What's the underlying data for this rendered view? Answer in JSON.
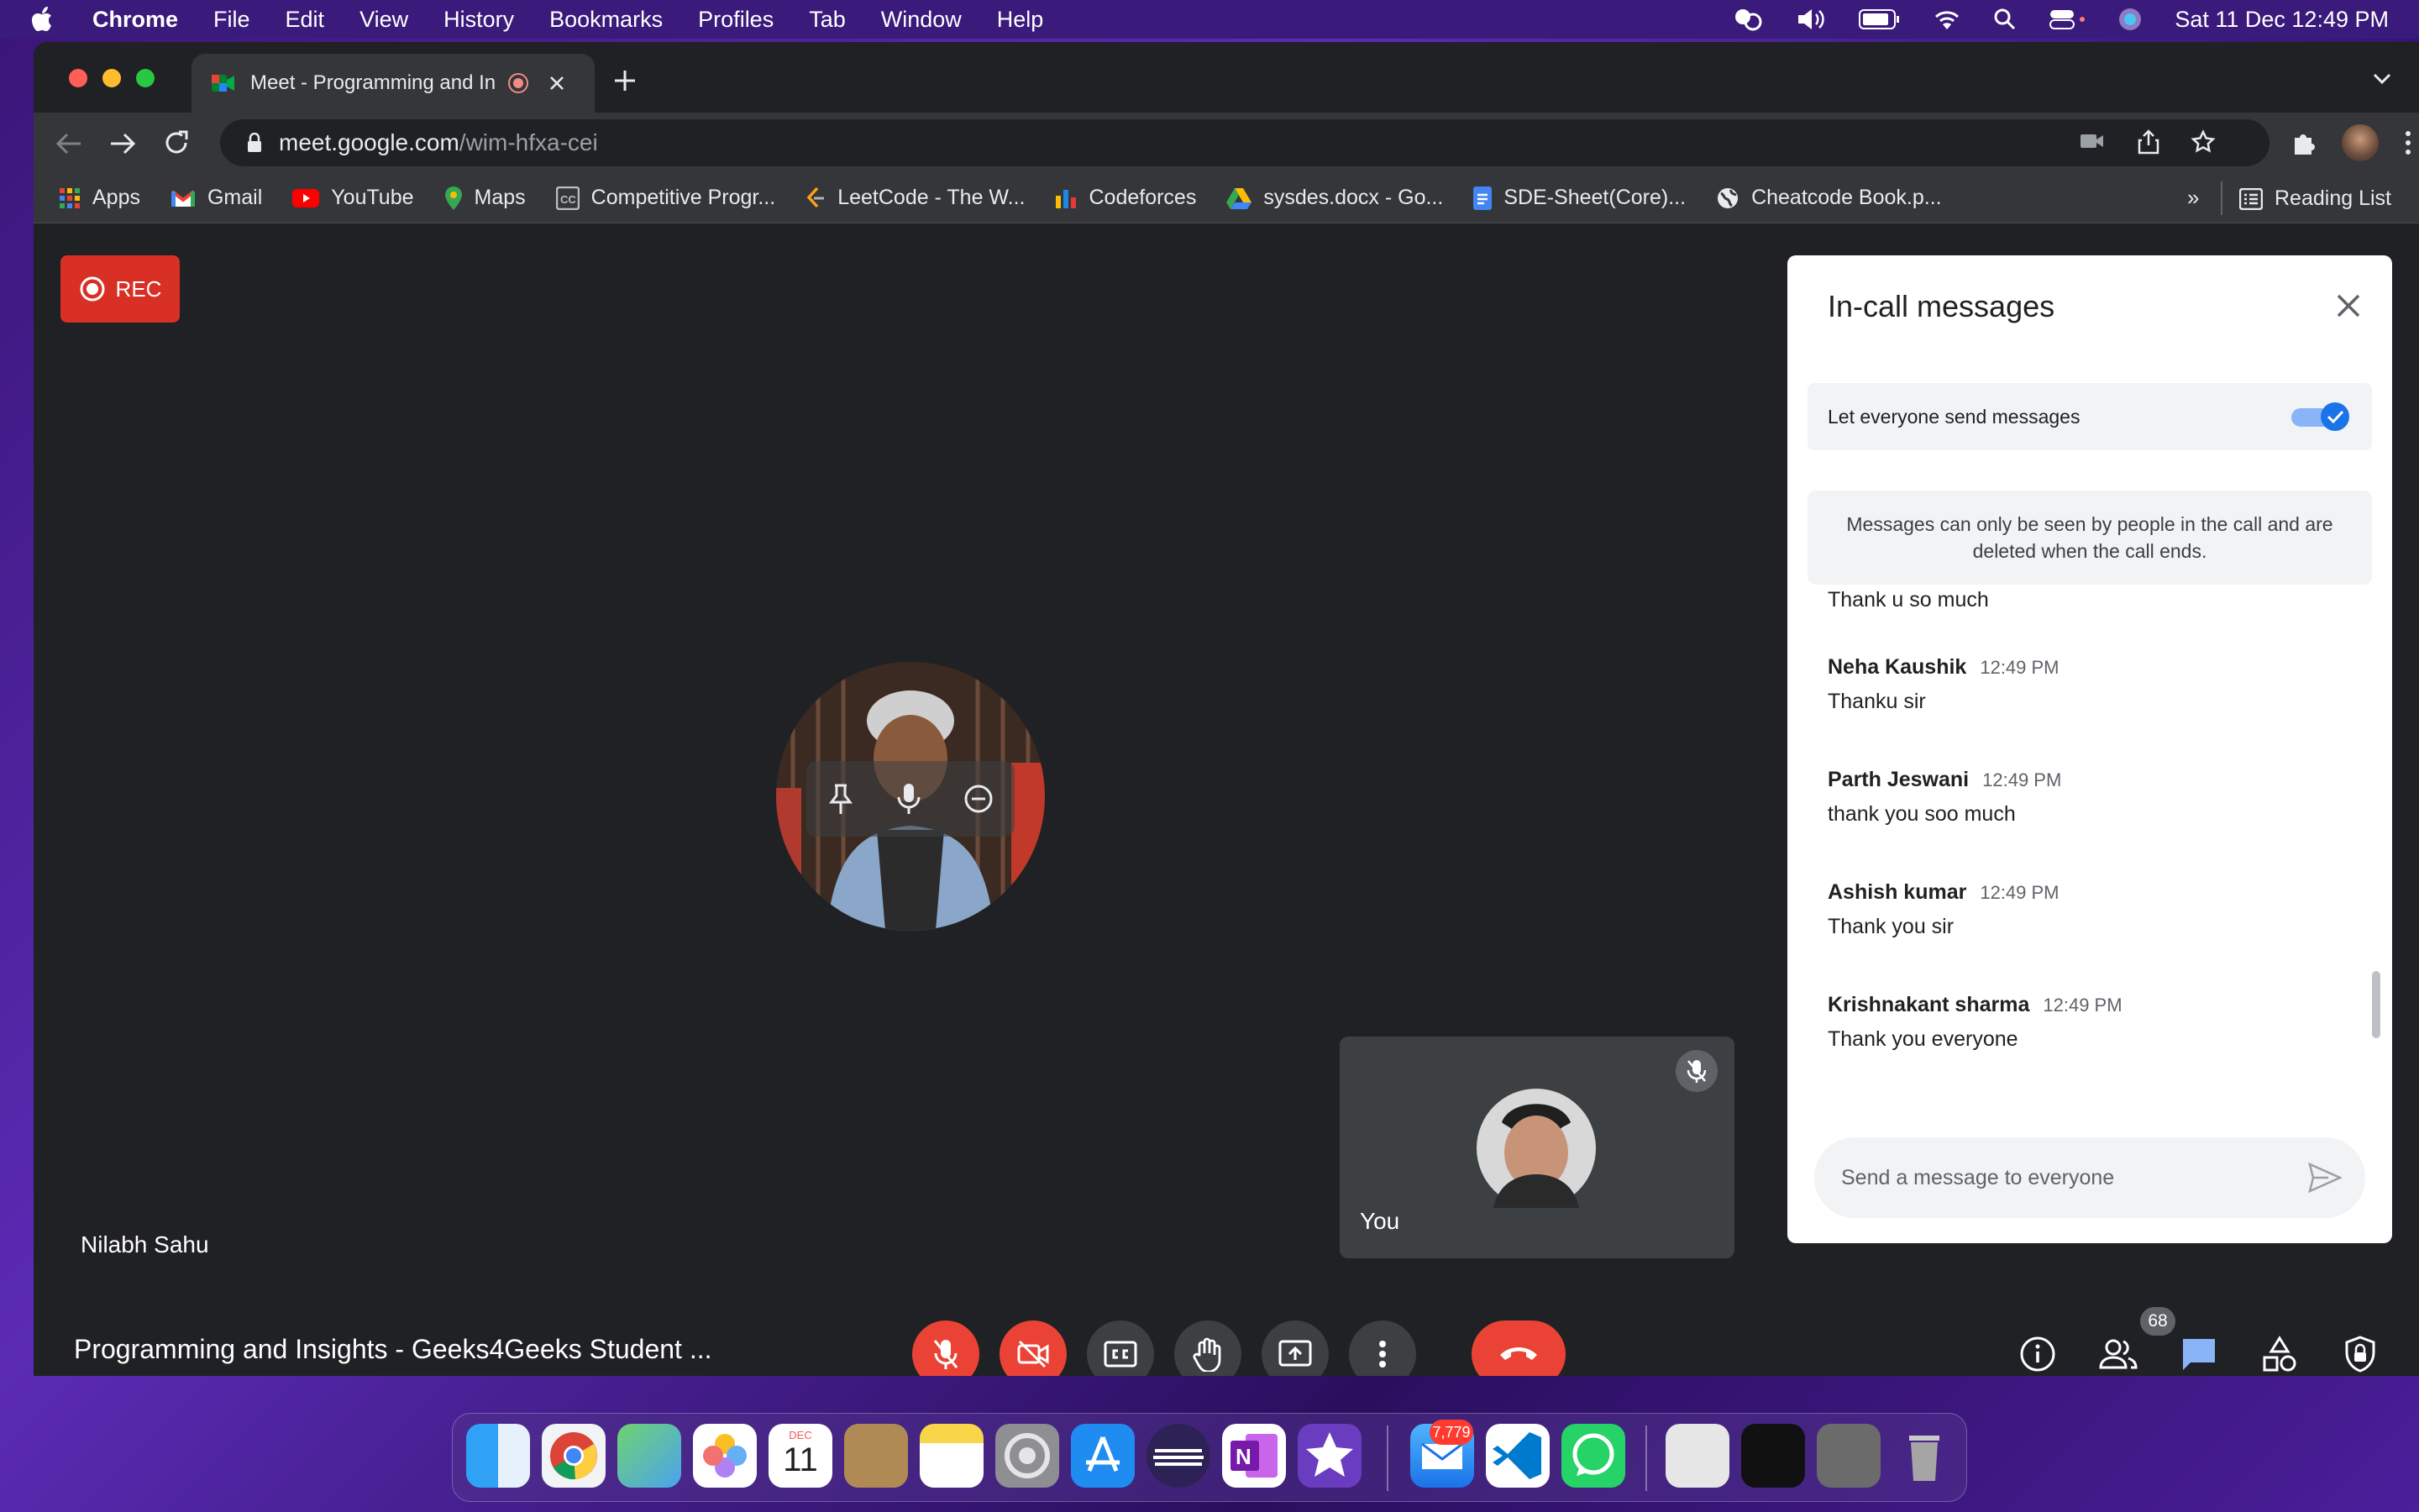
{
  "menubar": {
    "app": "Chrome",
    "items": [
      "File",
      "Edit",
      "View",
      "History",
      "Bookmarks",
      "Profiles",
      "Tab",
      "Window",
      "Help"
    ],
    "clock": "Sat 11 Dec  12:49 PM"
  },
  "browser": {
    "tab_title": "Meet - Programming and In",
    "url_host": "meet.google.com",
    "url_path": "/wim-hfxa-cei",
    "bookmarks": [
      {
        "label": "Apps",
        "icon": "apps-grid-icon",
        "color": "#e94235"
      },
      {
        "label": "Gmail",
        "icon": "gmail-icon",
        "color": "#ea4335"
      },
      {
        "label": "YouTube",
        "icon": "youtube-icon",
        "color": "#ff0000"
      },
      {
        "label": "Maps",
        "icon": "maps-pin-icon",
        "color": "#34a853"
      },
      {
        "label": "Competitive Progr...",
        "icon": "cc-icon",
        "color": "#9e9e9e"
      },
      {
        "label": "LeetCode - The W...",
        "icon": "leetcode-icon",
        "color": "#ffa116"
      },
      {
        "label": "Codeforces",
        "icon": "codeforces-icon",
        "color": "#1e88e5"
      },
      {
        "label": "sysdes.docx - Go...",
        "icon": "drive-icon",
        "color": "#fbbc04"
      },
      {
        "label": "SDE-Sheet(Core)...",
        "icon": "docs-icon",
        "color": "#4285f4"
      },
      {
        "label": "Cheatcode Book.p...",
        "icon": "globe-icon",
        "color": "#e8eaed"
      }
    ],
    "overflow": "»",
    "reading_list": "Reading List"
  },
  "meet": {
    "rec_label": "REC",
    "presenter_name": "Nilabh Sahu",
    "self_label": "You",
    "meeting_title": "Programming and Insights - Geeks4Geeks Student ...",
    "participant_count": "68",
    "accent": "#8ab4f8",
    "danger": "#ea4335"
  },
  "chat": {
    "title": "In-call messages",
    "toggle_label": "Let everyone send messages",
    "toggle_on": true,
    "notice": "Messages can only be seen by people in the call and are deleted when the call ends.",
    "partial_message": "Thank u so much",
    "messages": [
      {
        "sender": "Neha Kaushik",
        "time": "12:49 PM",
        "text": "Thanku sir"
      },
      {
        "sender": "Parth Jeswani",
        "time": "12:49 PM",
        "text": "thank you soo much"
      },
      {
        "sender": "Ashish kumar",
        "time": "12:49 PM",
        "text": "Thank you sir"
      },
      {
        "sender": "Krishnakant sharma",
        "time": "12:49 PM",
        "text": "Thank you everyone"
      }
    ],
    "input_placeholder": "Send a message to everyone"
  },
  "dock": {
    "calendar_month": "DEC",
    "calendar_day": "11",
    "mail_badge": "7,779"
  }
}
